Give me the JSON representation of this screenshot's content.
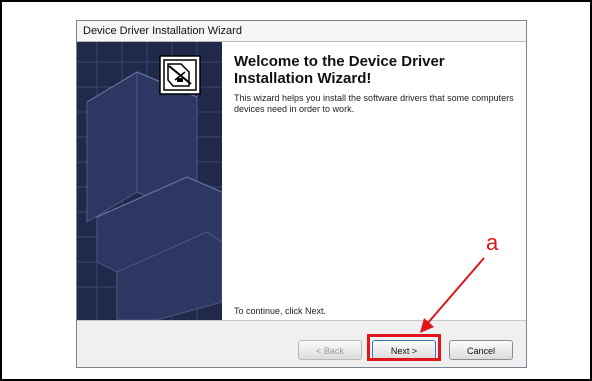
{
  "window": {
    "title": "Device Driver Installation Wizard"
  },
  "content": {
    "heading": "Welcome to the Device Driver Installation Wizard!",
    "description": "This wizard helps you install the software drivers that some computers devices need in order to work.",
    "continue_text": "To continue, click Next."
  },
  "buttons": {
    "back": "< Back",
    "next": "Next >",
    "cancel": "Cancel"
  },
  "annotation": {
    "letter": "a",
    "color": "#e1151a"
  },
  "colors": {
    "sidebar": "#20294a",
    "highlight": "#e1151a"
  }
}
